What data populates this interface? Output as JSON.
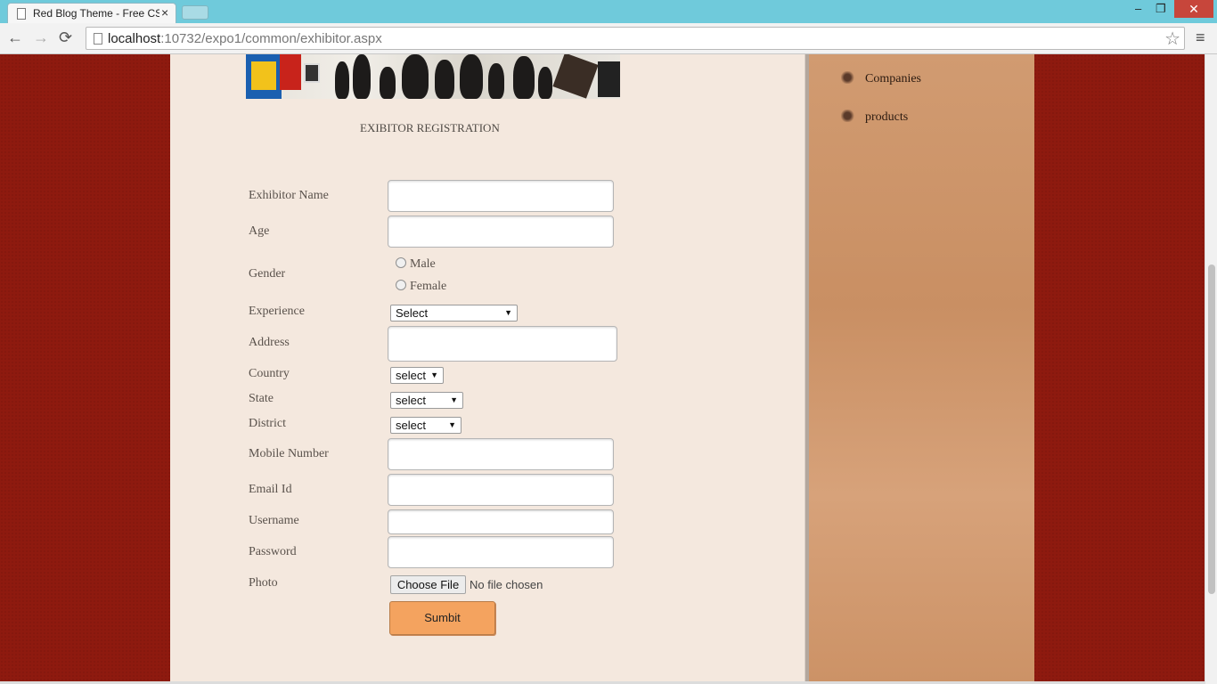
{
  "browser": {
    "tab_title": "Red Blog Theme - Free CS",
    "tab_close": "×",
    "url_host": "localhost",
    "url_rest": ":10732/expo1/common/exhibitor.aspx",
    "window_controls": {
      "minimize": "‒",
      "restore": "❐",
      "close": "✕"
    },
    "nav": {
      "back": "←",
      "forward": "→",
      "reload": "⟳",
      "star": "☆",
      "menu": "≡"
    }
  },
  "sidebar": {
    "items": [
      {
        "label": "Companies"
      },
      {
        "label": "products"
      }
    ]
  },
  "form": {
    "title": "EXIBITOR REGISTRATION",
    "labels": {
      "name": "Exhibitor Name",
      "age": "Age",
      "gender": "Gender",
      "experience": "Experience",
      "address": "Address",
      "country": "Country",
      "state": "State",
      "district": "District",
      "mobile": "Mobile Number",
      "email": "Email Id",
      "username": "Username",
      "password": "Password",
      "photo": "Photo"
    },
    "gender_options": [
      "Male",
      "Female"
    ],
    "experience_selected": "Select",
    "country_selected": "select",
    "state_selected": "select",
    "district_selected": "select",
    "file_button": "Choose File",
    "file_status": "No file chosen",
    "submit": "Sumbit"
  }
}
